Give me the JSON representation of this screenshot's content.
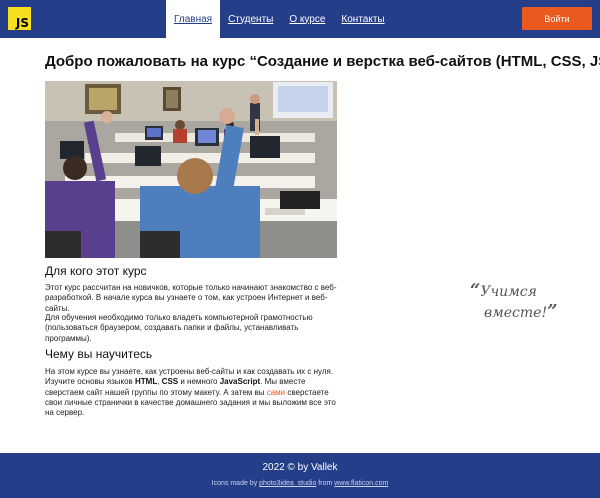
{
  "header": {
    "logo_text": "JS",
    "nav": [
      {
        "label": "Главная",
        "active": true
      },
      {
        "label": "Студенты",
        "active": false
      },
      {
        "label": "О курсе",
        "active": false
      },
      {
        "label": "Контакты",
        "active": false
      }
    ],
    "login_label": "Войти",
    "colors": {
      "bar": "#243e8a",
      "login": "#ea5a1e",
      "logo": "#f7df1e"
    }
  },
  "main": {
    "title": "Добро пожаловать на курс “Создание и верстка веб-сайтов (HTML, CSS, JS)”!",
    "photo_alt": "classroom-photo",
    "section1": {
      "heading": "Для кого этот курс",
      "p1": "Этот курс рассчитан на новичков, которые только начинают знакомство с веб-разработкой. В начале курса вы узнаете о том, как устроен Интернет и веб-сайты.",
      "p2": "Для обучения необходимо только владеть компьютерной грамотностью (пользоваться браузером, создавать папки и файлы, устанавливать программы)."
    },
    "section2": {
      "heading": "Чему вы научитесь",
      "t1": "На этом курсе вы узнаете, как устроены веб-сайты и как создавать их с нуля. Изучите основы языков ",
      "html": "HTML",
      "t2": ", ",
      "css": "CSS",
      "t3": " и немного ",
      "js": "JavaScript",
      "t4": ". Мы вместе сверстаем сайт нашей группы по этому макету. А затем вы ",
      "link": "сами",
      "t5": " сверстаете свои личные странички в качестве домашнего задания и мы выложим все это на сервер."
    },
    "quote": {
      "open": "“",
      "line1": "Учимся",
      "line2": "вместе!",
      "close": "”"
    }
  },
  "footer": {
    "copyright": "2022 © by Vallek",
    "credit_prefix": "Icons made by ",
    "credit_author": "photo3idea_studio",
    "credit_mid": " from ",
    "credit_site": "www.flaticon.com"
  }
}
